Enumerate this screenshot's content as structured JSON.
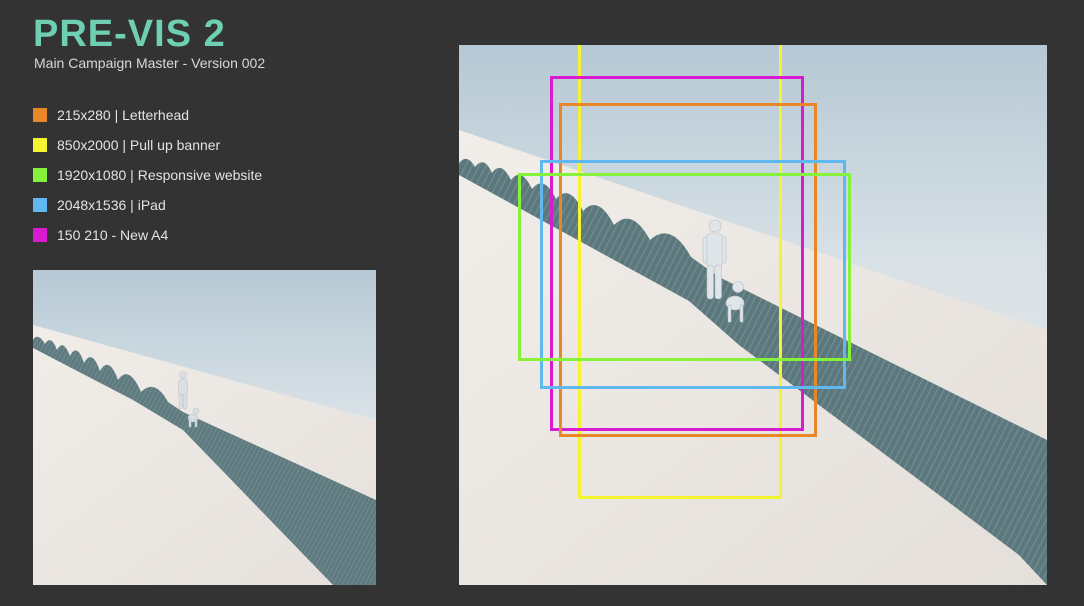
{
  "header": {
    "title": "PRE-VIS 2",
    "subtitle": "Main Campaign Master - Version 002"
  },
  "legend": {
    "items": [
      {
        "label": "215x280 | Letterhead",
        "color": "#e8862a"
      },
      {
        "label": "850x2000 | Pull up banner",
        "color": "#f4f52e"
      },
      {
        "label": "1920x1080 | Responsive website",
        "color": "#86f23b"
      },
      {
        "label": "2048x1536 | iPad",
        "color": "#5fb8f0"
      },
      {
        "label": "150 210 - New A4",
        "color": "#d81bd1"
      }
    ]
  },
  "colors": {
    "background": "#333333",
    "title": "#6fcfb3",
    "sky_top": "#b8cad6",
    "ground": "#ece8e4",
    "walkway": "#5f7b7f"
  },
  "icons": {
    "scene_preview": "scene-image",
    "figure": "person-with-dog-icon"
  }
}
